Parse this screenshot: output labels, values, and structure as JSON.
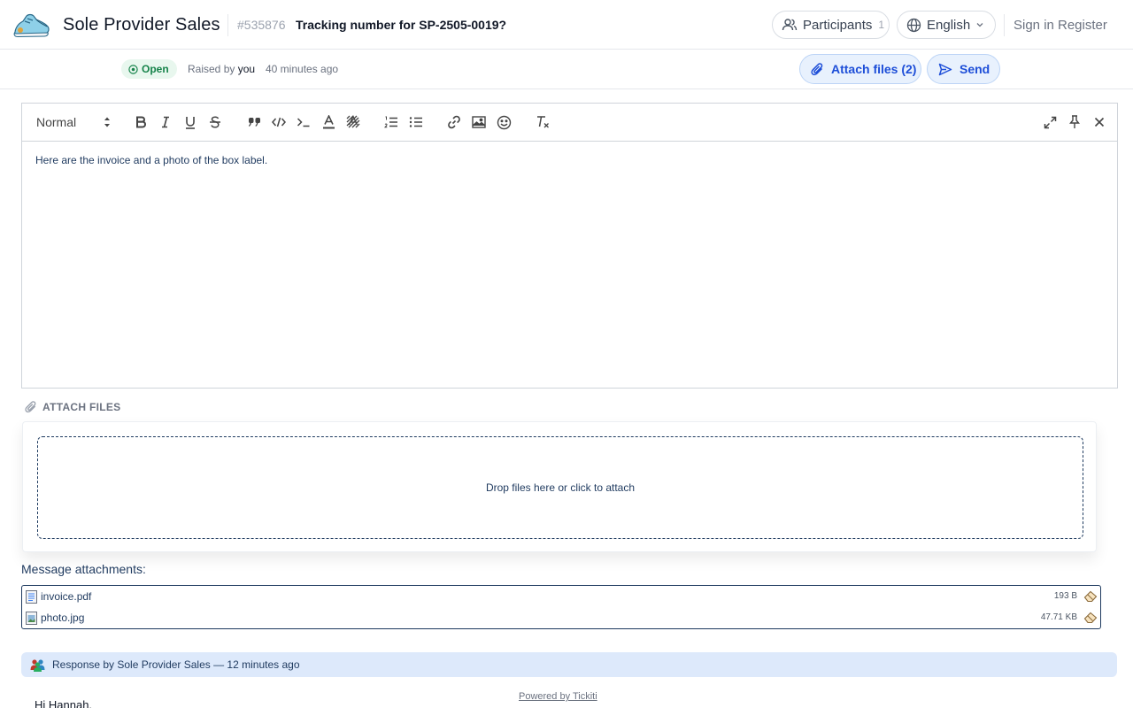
{
  "header": {
    "brand": "Sole Provider Sales",
    "ticket_id": "#535876",
    "ticket_title": "Tracking number for SP-2505-0019?",
    "participants_label": "Participants",
    "participants_count": "1",
    "language": "English",
    "sign_in": "Sign in",
    "register": "Register"
  },
  "subheader": {
    "status": "Open",
    "raised_by_prefix": "Raised by",
    "raised_by_user": "you",
    "time_ago": "40 minutes ago",
    "attach_button": "Attach files (2)",
    "send_button": "Send"
  },
  "editor": {
    "format_select": "Normal",
    "content": "Here are the invoice and a photo of the box label."
  },
  "attach": {
    "heading": "ATTACH FILES",
    "dropzone": "Drop files here or click to attach"
  },
  "attachments": {
    "label": "Message attachments:",
    "files": [
      {
        "name": "invoice.pdf",
        "size": "193 B"
      },
      {
        "name": "photo.jpg",
        "size": "47.71 KB"
      }
    ]
  },
  "response": {
    "title": "Response by Sole Provider Sales — 12 minutes ago",
    "greeting": "Hi Hannah,"
  },
  "footer": {
    "powered": "Powered by Tickiti"
  },
  "colors": {
    "accent": "#1d4ed8",
    "status_green": "#16834a",
    "text_navy": "#1f3a5f"
  }
}
